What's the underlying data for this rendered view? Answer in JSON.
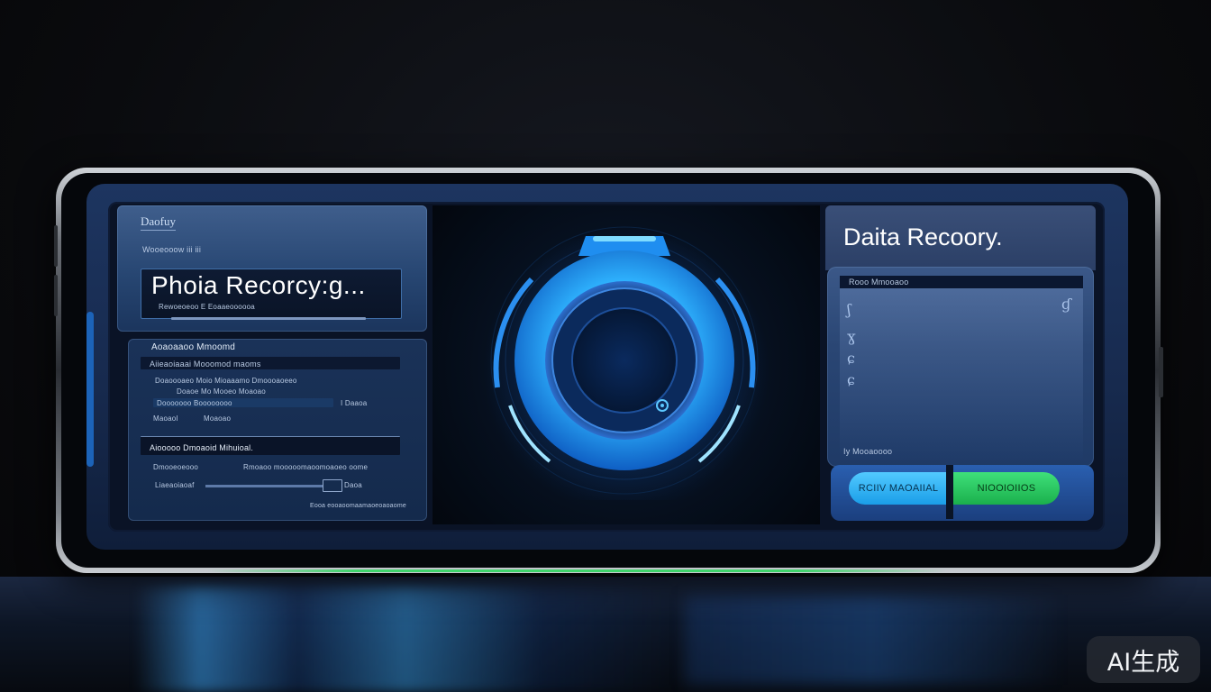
{
  "left_panel": {
    "logo": "Daofuy",
    "caption": "Wooeooow iii iii",
    "title": "Phoia Recorcy:g...",
    "title_sub": "Rewoeoeoo  E  Eoaaeoooooa",
    "section_heading": "Aoaoaaoo Mmoomd",
    "row1": "Aiieaoiaaai Mooomod maoms",
    "row2a": "Doaoooaeo Moio Mioaaamo Dmoooaoeeo",
    "row2b": "Doaoe Mo Mooeo Moaoao",
    "row3a": "Dooooooo Boooooooo",
    "row3b": "I Daaoa",
    "row4a": "Maoaol",
    "row4b": "Moaoao",
    "section2_heading": "Aiooooo Dmoaoid Mihuioal.",
    "row5a": "Dmooeoeooo",
    "row5b": "Rmoaoo mooooomaoomoaoeo oome",
    "slider_label": "Liaeaoiaoaf",
    "slider_value": "Daoa",
    "footer": "Eooa eooaoomaamaoeoaoaome"
  },
  "center": {
    "icon": "lock-dial-icon",
    "accent_color": "#2fb4ff"
  },
  "right_panel": {
    "title": "Daita Recoory.",
    "sub_label": "Rooo Mmooaoo",
    "status_label": "Iy Mooaoooo",
    "left_symbols": [
      "ʃ",
      "ɣ",
      "ɕ",
      "ɕ"
    ],
    "right_symbol": "ɠ",
    "btn_primary": "RCIIV MAOAIIAL",
    "btn_secondary": "NIOOIOIIOS",
    "primary_color": "#2aa8f0",
    "secondary_color": "#2ecb62"
  },
  "watermark": "AI生成"
}
